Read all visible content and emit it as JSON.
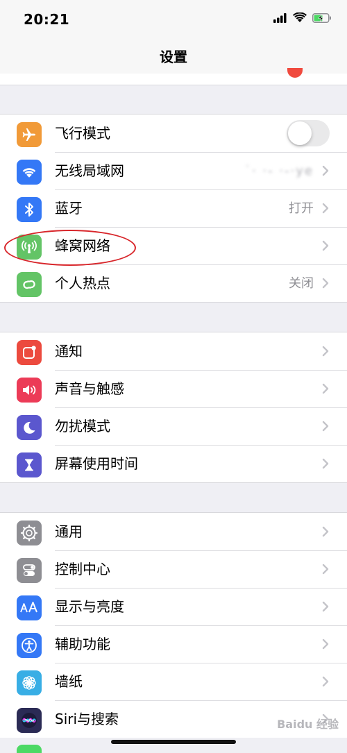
{
  "status_bar": {
    "time": "20:21",
    "icons": [
      "signal-icon",
      "wifi-icon",
      "battery-charging-icon"
    ]
  },
  "nav": {
    "title": "设置"
  },
  "groups": [
    {
      "rows": [
        {
          "id": "airplane",
          "label": "飞行模式",
          "icon": "airplane-icon",
          "color": "#f19a38",
          "accessory": "toggle",
          "toggle_on": false
        },
        {
          "id": "wifi",
          "label": "无线局域网",
          "icon": "wifi-icon",
          "color": "#3478f6",
          "value": "˙· ·‐ ·‐·уе",
          "accessory": "chevron"
        },
        {
          "id": "bluetooth",
          "label": "蓝牙",
          "icon": "bluetooth-icon",
          "color": "#3478f6",
          "value": "打开",
          "accessory": "chevron"
        },
        {
          "id": "cellular",
          "label": "蜂窝网络",
          "icon": "antenna-icon",
          "color": "#63c466",
          "accessory": "chevron"
        },
        {
          "id": "hotspot",
          "label": "个人热点",
          "icon": "link-icon",
          "color": "#63c466",
          "value": "关闭",
          "accessory": "chevron"
        }
      ]
    },
    {
      "rows": [
        {
          "id": "notifications",
          "label": "通知",
          "icon": "notification-icon",
          "color": "#ec4a3e",
          "accessory": "chevron"
        },
        {
          "id": "sounds",
          "label": "声音与触感",
          "icon": "speaker-icon",
          "color": "#ec3b57",
          "accessory": "chevron"
        },
        {
          "id": "dnd",
          "label": "勿扰模式",
          "icon": "moon-icon",
          "color": "#5b57ce",
          "accessory": "chevron"
        },
        {
          "id": "screentime",
          "label": "屏幕使用时间",
          "icon": "hourglass-icon",
          "color": "#5b57ce",
          "accessory": "chevron"
        }
      ]
    },
    {
      "rows": [
        {
          "id": "general",
          "label": "通用",
          "icon": "gear-icon",
          "color": "#8e8e93",
          "accessory": "chevron"
        },
        {
          "id": "control",
          "label": "控制中心",
          "icon": "switches-icon",
          "color": "#8e8e93",
          "accessory": "chevron"
        },
        {
          "id": "display",
          "label": "显示与亮度",
          "icon": "text-size-icon",
          "color": "#3478f6",
          "accessory": "chevron"
        },
        {
          "id": "accessibility",
          "label": "辅助功能",
          "icon": "accessibility-icon",
          "color": "#3478f6",
          "accessory": "chevron"
        },
        {
          "id": "wallpaper",
          "label": "墙纸",
          "icon": "flower-icon",
          "color": "#38aee5",
          "accessory": "chevron"
        },
        {
          "id": "siri",
          "label": "Siri与搜索",
          "icon": "siri-icon",
          "color": "#2b2b55",
          "accessory": "chevron"
        }
      ]
    }
  ],
  "watermark": "Baidu 经验",
  "annotation_color": "#d8262b"
}
